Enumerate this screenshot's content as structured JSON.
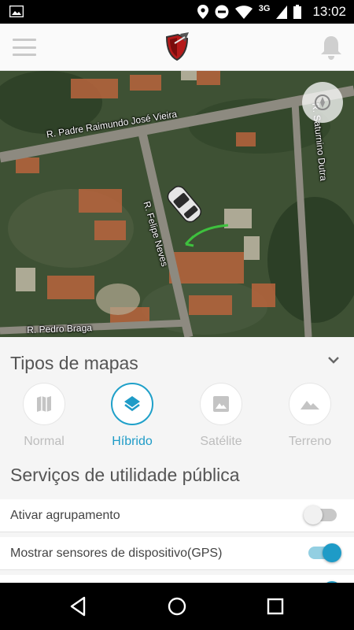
{
  "status_bar": {
    "time": "13:02",
    "network": "3G",
    "icons": [
      "image-icon",
      "location-icon",
      "do-not-disturb-icon",
      "wifi-icon",
      "signal-icon",
      "battery-icon"
    ]
  },
  "app_bar": {
    "menu_icon": "hamburger-menu-icon",
    "logo": "shield-logo",
    "notifications_icon": "bell-icon"
  },
  "map": {
    "streets": {
      "padre": "R. Padre Raimundo José Vieira",
      "saturnino": "R. Saturnino Dutra",
      "felipe": "R. Felipe Neves",
      "pedro": "R. Pedro Braga"
    },
    "compass_icon": "compass-icon"
  },
  "map_types": {
    "title": "Tipos de mapas",
    "collapse_icon": "chevron-down-icon",
    "options": [
      {
        "label": "Normal",
        "icon": "map-icon",
        "selected": false
      },
      {
        "label": "Híbrido",
        "icon": "layers-icon",
        "selected": true
      },
      {
        "label": "Satélite",
        "icon": "image-icon",
        "selected": false
      },
      {
        "label": "Terreno",
        "icon": "terrain-icon",
        "selected": false
      }
    ]
  },
  "services": {
    "title": "Serviços de utilidade pública",
    "rows": [
      {
        "label": "Ativar agrupamento",
        "enabled": false
      },
      {
        "label": "Mostrar sensores de dispositivo(GPS)",
        "enabled": true
      }
    ]
  },
  "colors": {
    "accent": "#1e9bc7",
    "inactive": "#bdbdbd"
  },
  "nav_bar": {
    "icons": [
      "back-icon",
      "home-icon",
      "recents-icon"
    ]
  }
}
